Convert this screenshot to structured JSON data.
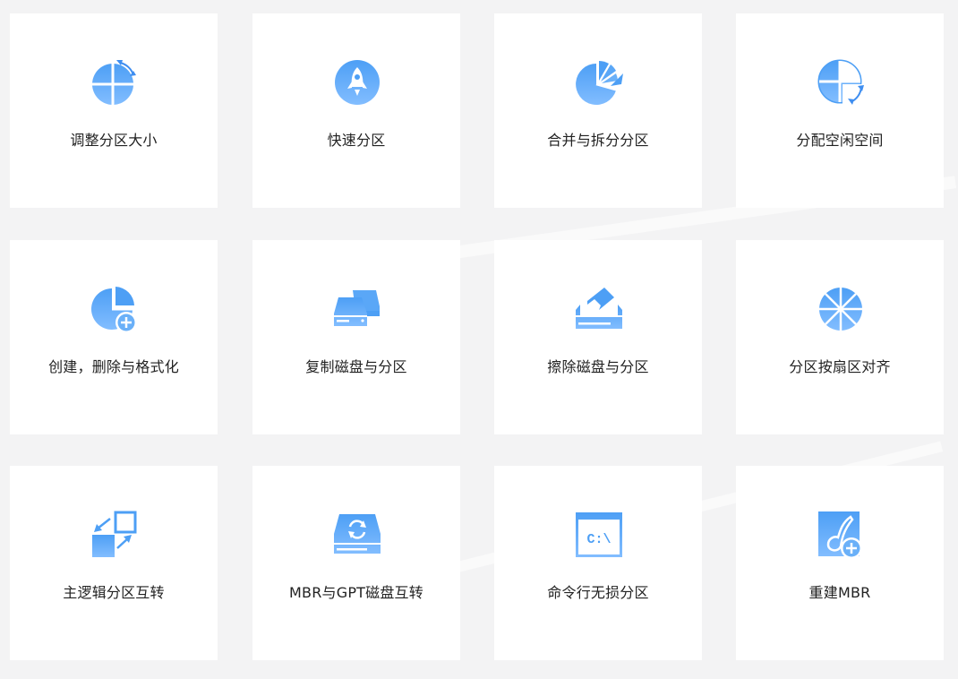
{
  "colors": {
    "accent_top": "#4d9ff5",
    "accent_bottom": "#79b9ff",
    "card_bg": "#ffffff",
    "page_bg": "#f3f3f4",
    "label_text": "#222222"
  },
  "features": [
    {
      "label": "调整分区大小",
      "icon": "resize-partition-icon"
    },
    {
      "label": "快速分区",
      "icon": "rocket-icon"
    },
    {
      "label": "合并与拆分分区",
      "icon": "merge-split-pie-icon"
    },
    {
      "label": "分配空闲空间",
      "icon": "allocate-space-icon"
    },
    {
      "label": "创建，删除与格式化",
      "icon": "create-partition-icon"
    },
    {
      "label": "复制磁盘与分区",
      "icon": "copy-disk-icon"
    },
    {
      "label": "擦除磁盘与分区",
      "icon": "wipe-disk-icon"
    },
    {
      "label": "分区按扇区对齐",
      "icon": "sector-align-icon"
    },
    {
      "label": "主逻辑分区互转",
      "icon": "primary-logical-convert-icon"
    },
    {
      "label": "MBR与GPT磁盘互转",
      "icon": "mbr-gpt-convert-icon"
    },
    {
      "label": "命令行无损分区",
      "icon": "command-line-icon"
    },
    {
      "label": "重建MBR",
      "icon": "rebuild-mbr-icon"
    }
  ],
  "command_icon_text": "C:\\"
}
